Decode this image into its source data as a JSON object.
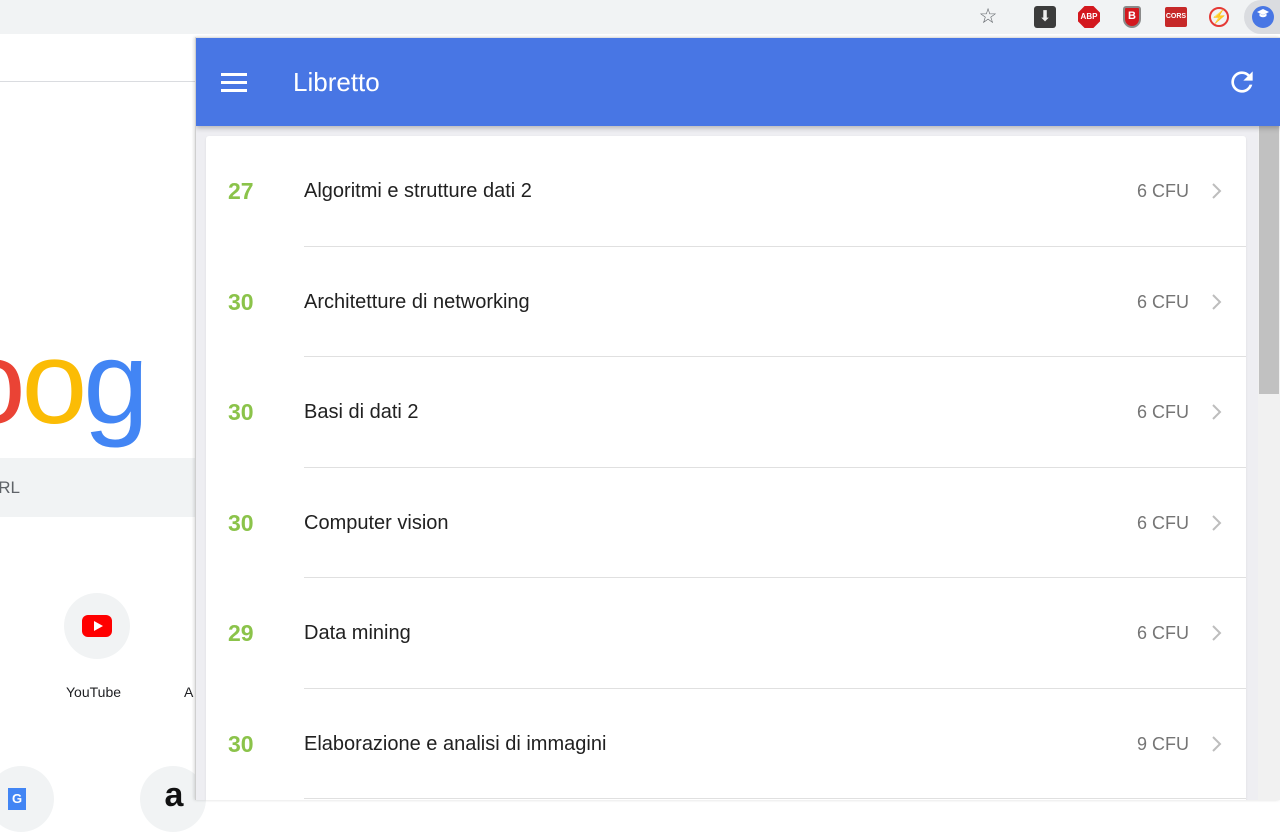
{
  "browser": {
    "toolbar": {
      "bookmark_icon": "star-icon",
      "extensions": [
        {
          "name": "download-extension",
          "icon": "download-arrow-icon",
          "label": "⬇"
        },
        {
          "name": "adblock-plus-extension",
          "icon": "abp-icon",
          "label": "ABP"
        },
        {
          "name": "b-shield-extension",
          "icon": "shield-b-icon",
          "label": "B"
        },
        {
          "name": "cors-extension",
          "icon": "cors-icon",
          "label": "CORS"
        },
        {
          "name": "flash-block-extension",
          "icon": "no-flash-icon",
          "label": "⚡"
        },
        {
          "name": "libretto-extension",
          "icon": "graduation-cap-icon",
          "label": "🎓"
        }
      ]
    },
    "new_tab": {
      "logo_partial": [
        "o",
        "o",
        "g"
      ],
      "search_placeholder_partial": "URL",
      "shortcuts": [
        {
          "label": "YouTube",
          "icon": "youtube-icon"
        },
        {
          "label": "A",
          "icon": ""
        },
        {
          "label": "",
          "icon": "google-translate-icon"
        },
        {
          "label": "",
          "icon": "amazon-icon"
        }
      ]
    }
  },
  "popup": {
    "title": "Libretto",
    "menu_icon": "hamburger-menu-icon",
    "refresh_icon": "refresh-icon",
    "accent_color": "#4876e4",
    "grade_color": "#8bc34a",
    "exams": [
      {
        "grade": "27",
        "course": "Algoritmi e strutture dati 2",
        "credits": "6 CFU"
      },
      {
        "grade": "30",
        "course": "Architetture di networking",
        "credits": "6 CFU"
      },
      {
        "grade": "30",
        "course": "Basi di dati 2",
        "credits": "6 CFU"
      },
      {
        "grade": "30",
        "course": "Computer vision",
        "credits": "6 CFU"
      },
      {
        "grade": "29",
        "course": "Data mining",
        "credits": "6 CFU"
      },
      {
        "grade": "30",
        "course": "Elaborazione e analisi di immagini",
        "credits": "9 CFU"
      }
    ]
  }
}
